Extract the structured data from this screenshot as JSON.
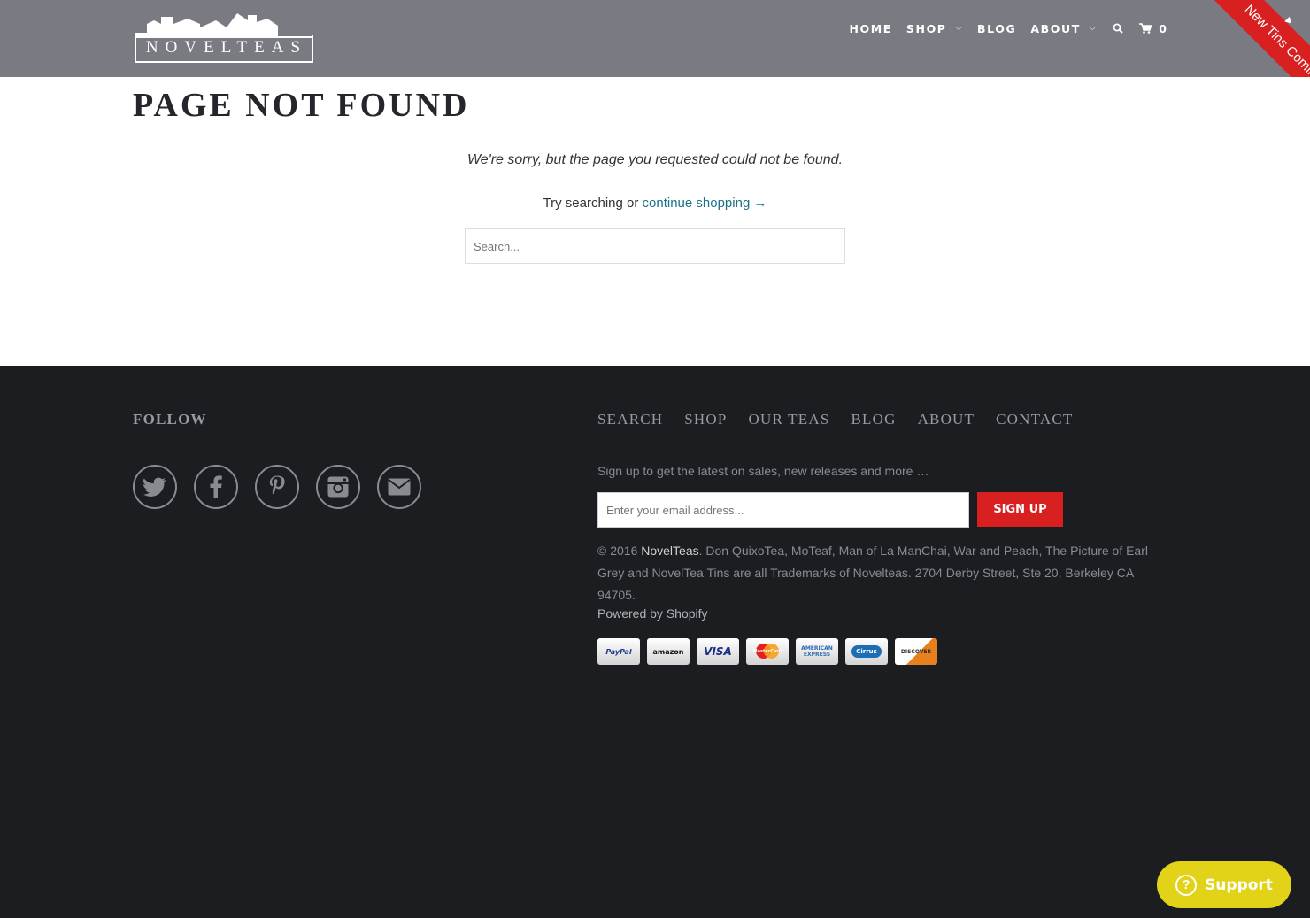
{
  "brand": {
    "logo_text": "NOVELTEAS"
  },
  "nav": {
    "items": [
      {
        "label": "HOME",
        "has_dropdown": false
      },
      {
        "label": "SHOP",
        "has_dropdown": true
      },
      {
        "label": "BLOG",
        "has_dropdown": false
      },
      {
        "label": "ABOUT",
        "has_dropdown": true
      }
    ],
    "cart_count": "0",
    "icons": [
      "search-icon",
      "cart-icon"
    ]
  },
  "ribbon": {
    "label": "New Tins Coming",
    "color": "#d92020"
  },
  "main": {
    "title": "PAGE NOT FOUND",
    "sorry_text": "We're sorry, but the page you requested could not be found.",
    "try_prefix": "Try searching or ",
    "continue_link": "continue shopping →",
    "search_placeholder": "Search..."
  },
  "footer": {
    "follow_heading": "FOLLOW",
    "social_icons": [
      "twitter-icon",
      "facebook-icon",
      "pinterest-icon",
      "instagram-icon",
      "email-icon"
    ],
    "links": [
      "SEARCH",
      "SHOP",
      "OUR TEAS",
      "BLOG",
      "ABOUT",
      "CONTACT"
    ],
    "signup_text": "Sign up to get the latest on sales, new releases and more …",
    "email_placeholder": "Enter your email address...",
    "signup_button": "SIGN UP",
    "copyright_prefix": "© 2016 ",
    "copyright_brand": "NovelTeas",
    "copyright_rest": ". Don QuixoTea, MoTeaf, Man of La ManChai, War and Peach, The Picture of Earl Grey and NovelTea Tins are all Trademarks of Novelteas. 2704 Derby Street, Ste 20, Berkeley CA 94705.",
    "powered_by": "Powered by Shopify",
    "payments": [
      {
        "name": "PayPal",
        "label": "PayPal",
        "color": "#1e3a8a"
      },
      {
        "name": "Amazon",
        "label": "amazon",
        "color": "#111111"
      },
      {
        "name": "Visa",
        "label": "VISA",
        "color": "#1a2f85"
      },
      {
        "name": "MasterCard",
        "label": "MasterCard",
        "color": "#e8501c"
      },
      {
        "name": "American Express",
        "label": "AMERICAN EXPRESS",
        "color": "#2d6cb3"
      },
      {
        "name": "Cirrus",
        "label": "Cirrus",
        "color": "#1d6db2"
      },
      {
        "name": "Discover",
        "label": "DISCOVER",
        "color": "#333333"
      }
    ]
  },
  "support": {
    "label": "Support",
    "color": "#e2d218"
  },
  "colors": {
    "header_bg": "#7a7b82",
    "footer_bg": "#1c1d21",
    "accent": "#d92020",
    "link": "#1a7286"
  }
}
